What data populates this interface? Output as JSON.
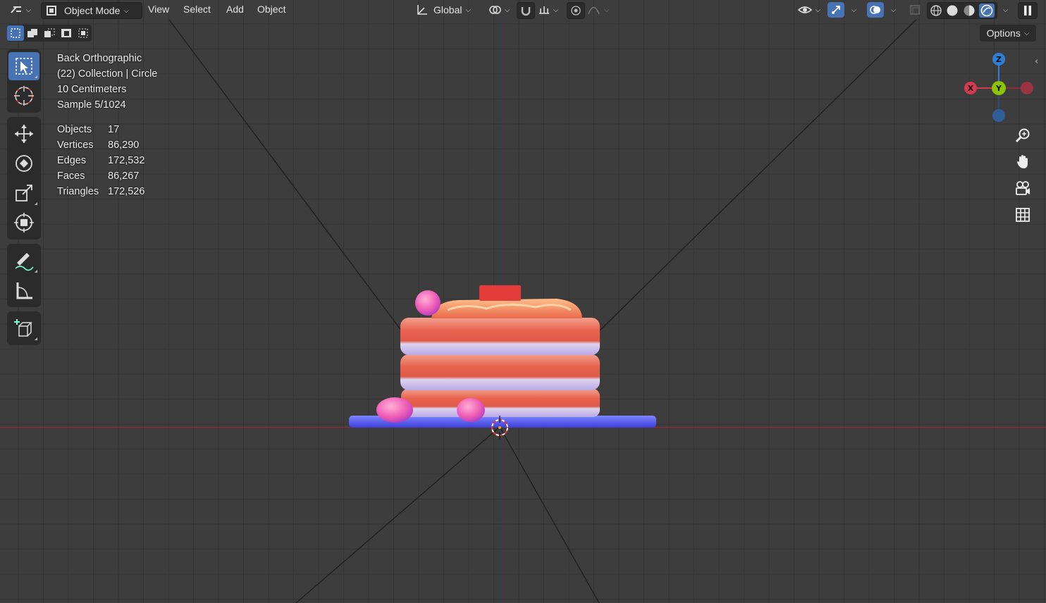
{
  "header": {
    "mode_label": "Object Mode",
    "menus": [
      "View",
      "Select",
      "Add",
      "Object"
    ],
    "transform_orientation": "Global",
    "options_label": "Options"
  },
  "overlay": {
    "view_name": "Back Orthographic",
    "collection": "(22) Collection | Circle",
    "scale": "10 Centimeters",
    "sample": "Sample 5/1024"
  },
  "stats": [
    {
      "label": "Objects",
      "value": "17"
    },
    {
      "label": "Vertices",
      "value": "86,290"
    },
    {
      "label": "Edges",
      "value": "172,532"
    },
    {
      "label": "Faces",
      "value": "86,267"
    },
    {
      "label": "Triangles",
      "value": "172,526"
    }
  ],
  "gizmo": {
    "x": "X",
    "y": "Y",
    "z": "Z"
  },
  "colors": {
    "accent": "#4772b3",
    "axis_x": "#d33a4f",
    "axis_y": "#8bc400",
    "axis_z": "#2f7fd4"
  }
}
